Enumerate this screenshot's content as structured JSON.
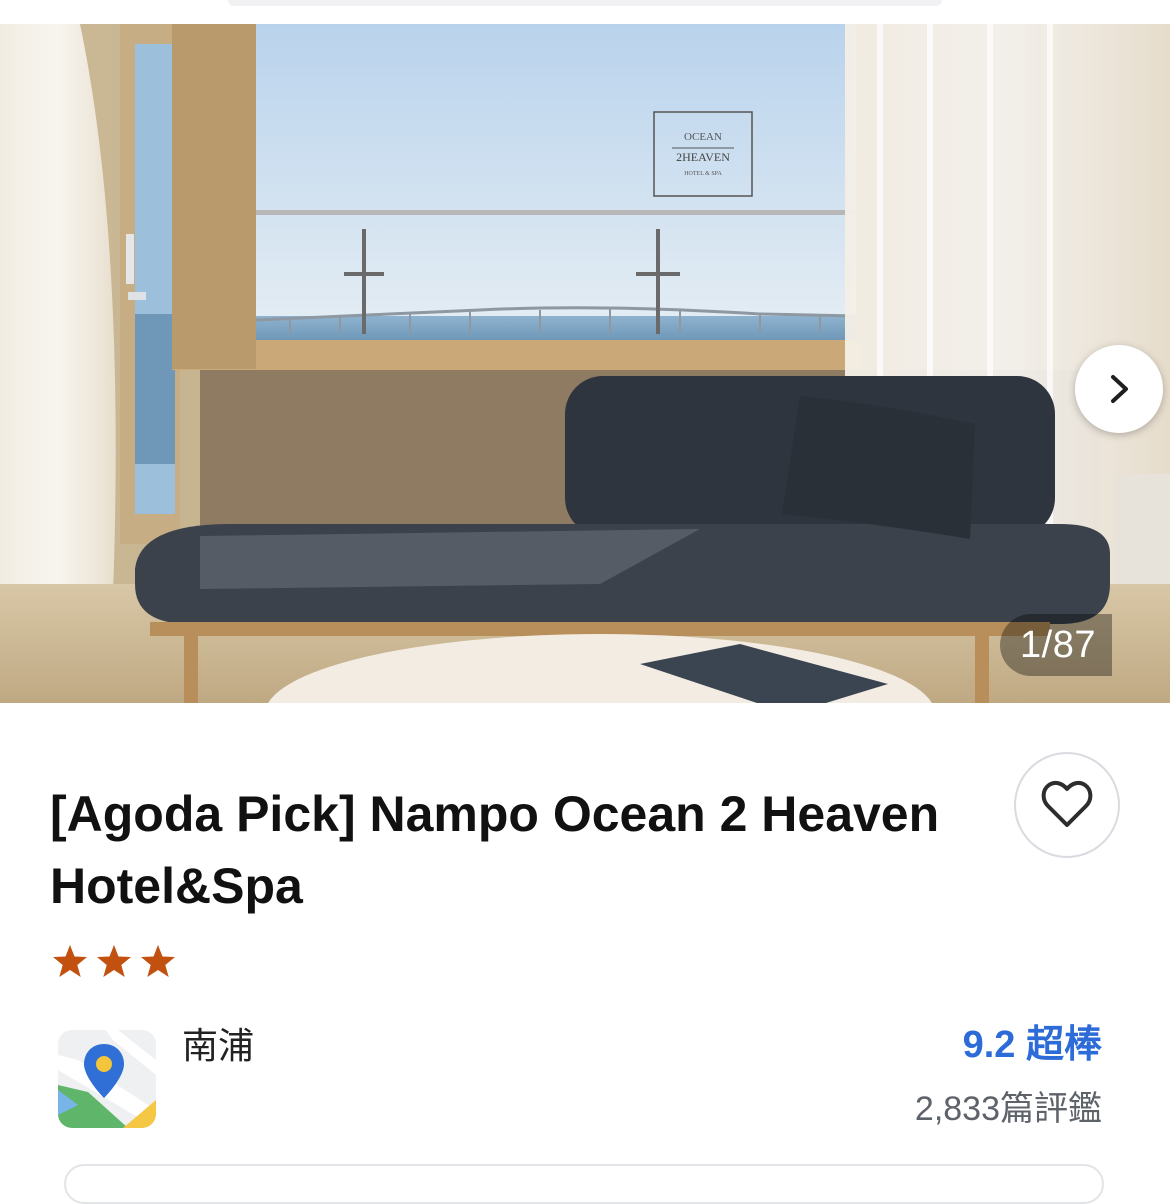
{
  "gallery": {
    "counter": "1/87",
    "photo_logo": {
      "line1": "OCEAN",
      "line2": "2HEAVEN",
      "line3": "HOTEL & SPA"
    }
  },
  "hotel": {
    "title": "[Agoda Pick] Nampo Ocean 2 Heaven Hotel&Spa",
    "star_rating": 3,
    "star_color": "#c2510f",
    "area": "南浦",
    "score": "9.2 超棒",
    "reviews": "2,833篇評鑑"
  },
  "icons": {
    "next": "chevron-right-icon",
    "favorite": "heart-outline-icon",
    "map": "map-pin-icon",
    "star": "star-icon"
  },
  "colors": {
    "accent": "#2c6bd8",
    "star": "#c2510f"
  }
}
